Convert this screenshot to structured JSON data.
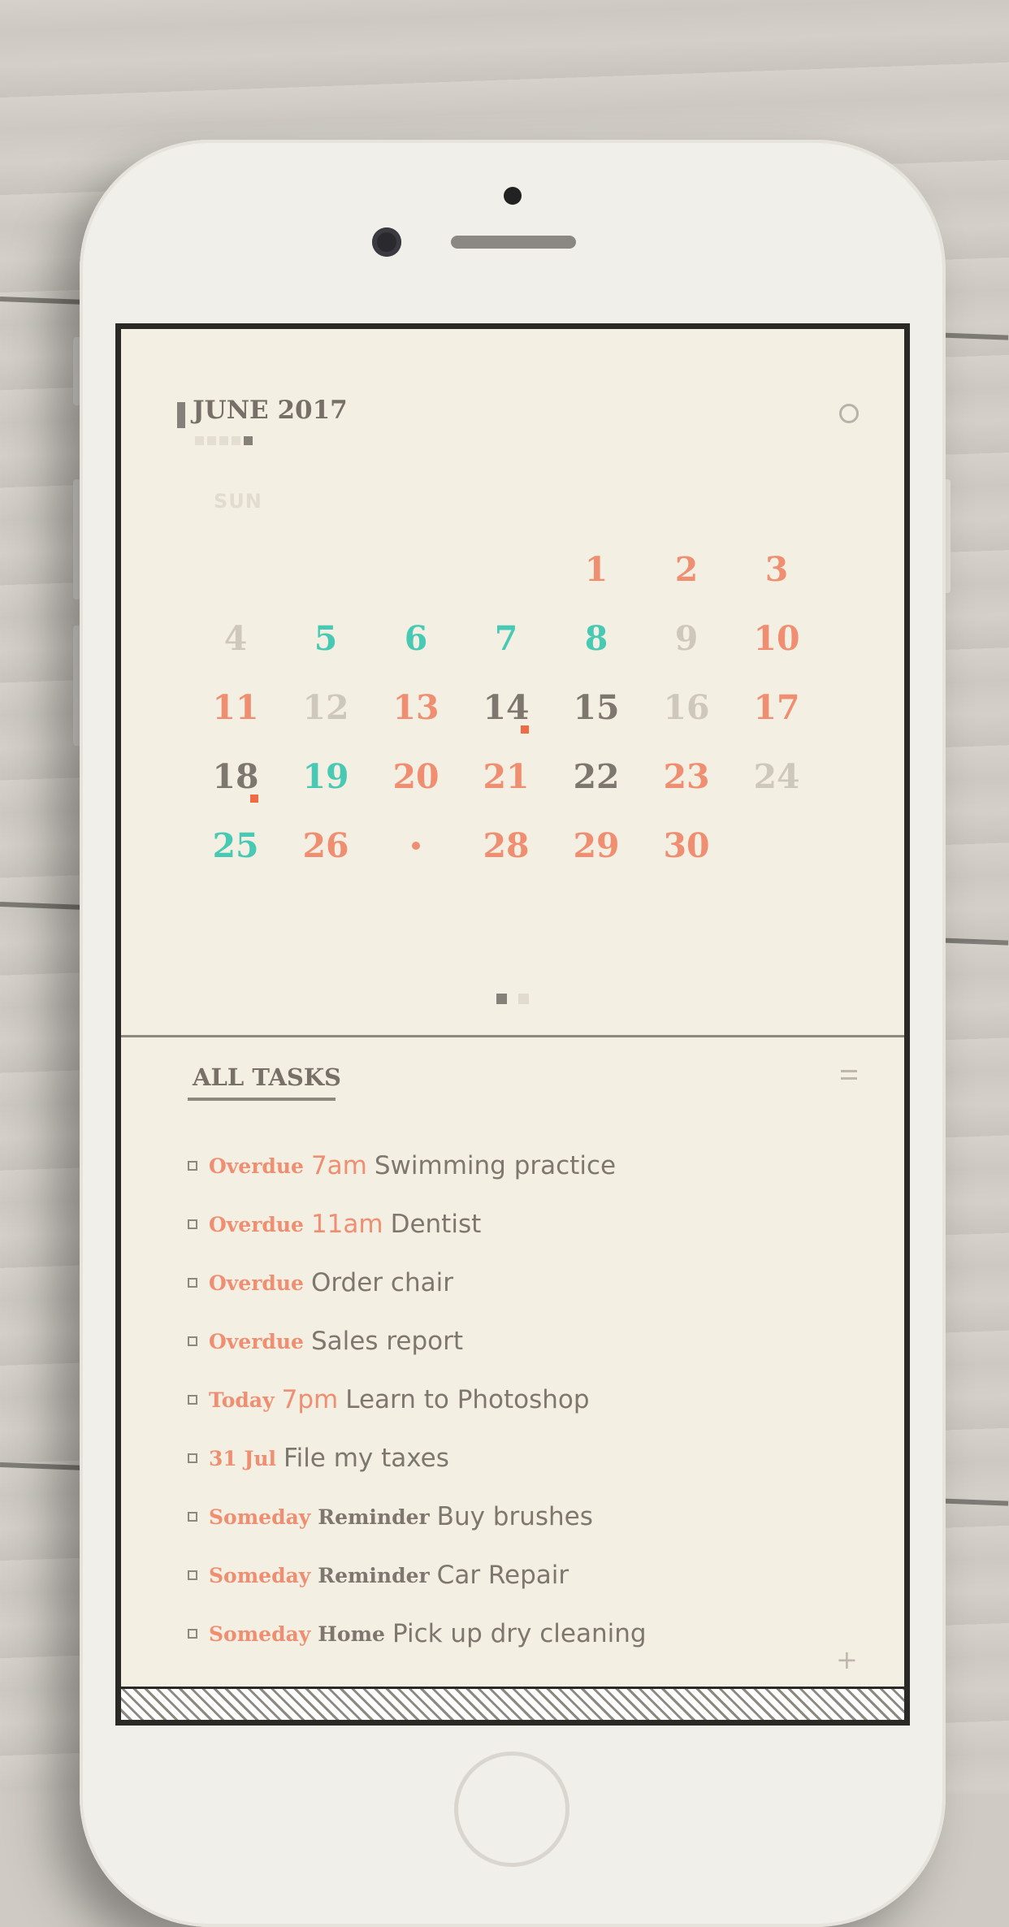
{
  "calendar": {
    "month_title": "JUNE 2017",
    "weekday_label": "SUN",
    "month_indicator_count": 5,
    "weeks": [
      [
        null,
        null,
        null,
        null,
        {
          "d": "1",
          "c": "coral"
        },
        {
          "d": "2",
          "c": "coral"
        },
        {
          "d": "3",
          "c": "coral"
        }
      ],
      [
        {
          "d": "4",
          "c": "light"
        },
        {
          "d": "5",
          "c": "teal"
        },
        {
          "d": "6",
          "c": "teal"
        },
        {
          "d": "7",
          "c": "teal"
        },
        {
          "d": "8",
          "c": "teal"
        },
        {
          "d": "9",
          "c": "light"
        },
        {
          "d": "10",
          "c": "coral"
        }
      ],
      [
        {
          "d": "11",
          "c": "coral"
        },
        {
          "d": "12",
          "c": "light"
        },
        {
          "d": "13",
          "c": "coral"
        },
        {
          "d": "14",
          "c": "grey",
          "event": true
        },
        {
          "d": "15",
          "c": "grey"
        },
        {
          "d": "16",
          "c": "light"
        },
        {
          "d": "17",
          "c": "coral"
        }
      ],
      [
        {
          "d": "18",
          "c": "grey",
          "event": true
        },
        {
          "d": "19",
          "c": "teal"
        },
        {
          "d": "20",
          "c": "coral"
        },
        {
          "d": "21",
          "c": "coral"
        },
        {
          "d": "22",
          "c": "grey"
        },
        {
          "d": "23",
          "c": "coral"
        },
        {
          "d": "24",
          "c": "light"
        }
      ],
      [
        {
          "d": "25",
          "c": "teal"
        },
        {
          "d": "26",
          "c": "coral"
        },
        {
          "d": "",
          "c": "coral",
          "today": true
        },
        {
          "d": "28",
          "c": "coral"
        },
        {
          "d": "29",
          "c": "coral"
        },
        {
          "d": "30",
          "c": "coral"
        },
        null
      ]
    ]
  },
  "tasks_header": {
    "title": "ALL TASKS"
  },
  "tasks": [
    {
      "when": "Overdue",
      "time": "7am",
      "tag": "",
      "title": "Swimming practice"
    },
    {
      "when": "Overdue",
      "time": "11am",
      "tag": "",
      "title": "Dentist"
    },
    {
      "when": "Overdue",
      "time": "",
      "tag": "",
      "title": "Order chair"
    },
    {
      "when": "Overdue",
      "time": "",
      "tag": "",
      "title": "Sales report"
    },
    {
      "when": "Today",
      "time": "7pm",
      "tag": "",
      "title": "Learn to Photoshop"
    },
    {
      "when": "31 Jul",
      "time": "",
      "tag": "",
      "title": "File my taxes"
    },
    {
      "when": "Someday",
      "time": "",
      "tag": "Reminder",
      "title": "Buy brushes"
    },
    {
      "when": "Someday",
      "time": "",
      "tag": "Reminder",
      "title": "Car Repair"
    },
    {
      "when": "Someday",
      "time": "",
      "tag": "Home",
      "title": "Pick up dry cleaning"
    }
  ],
  "icons": {
    "settings": "circle-icon",
    "menu": "menu-icon",
    "add": "plus-icon",
    "add_glyph": "+"
  },
  "colors": {
    "accent_coral": "#ef8e70",
    "accent_teal": "#47c9b4",
    "text_grey": "#7d776f",
    "background": "#f4efe3"
  }
}
